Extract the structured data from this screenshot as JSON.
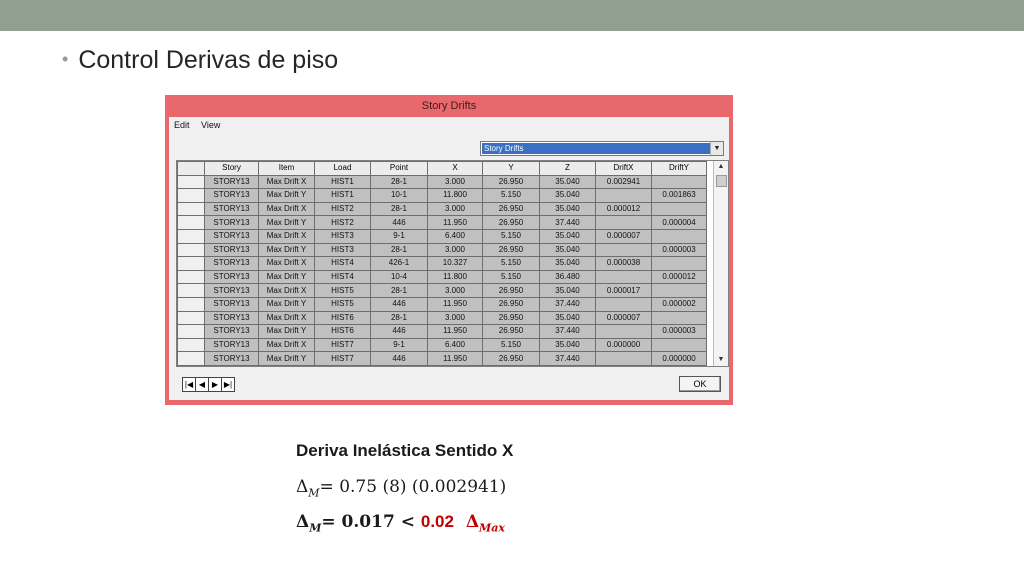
{
  "slide": {
    "title": "Control Derivas de piso",
    "bullet": "•"
  },
  "window": {
    "title": "Story Drifts",
    "menu": [
      "Edit",
      "View"
    ],
    "combo_value": "Story Drifts",
    "ok_label": "OK",
    "nav": [
      "|◀",
      "◀",
      "▶",
      "▶|"
    ],
    "columns": [
      "Story",
      "Item",
      "Load",
      "Point",
      "X",
      "Y",
      "Z",
      "DriftX",
      "DriftY"
    ],
    "rows": [
      [
        "STORY13",
        "Max Drift X",
        "HIST1",
        "28-1",
        "3.000",
        "26.950",
        "35.040",
        "0.002941",
        ""
      ],
      [
        "STORY13",
        "Max Drift Y",
        "HIST1",
        "10-1",
        "11.800",
        "5.150",
        "35.040",
        "",
        "0.001863"
      ],
      [
        "STORY13",
        "Max Drift X",
        "HIST2",
        "28-1",
        "3.000",
        "26.950",
        "35.040",
        "0.000012",
        ""
      ],
      [
        "STORY13",
        "Max Drift Y",
        "HIST2",
        "446",
        "11.950",
        "26.950",
        "37.440",
        "",
        "0.000004"
      ],
      [
        "STORY13",
        "Max Drift X",
        "HIST3",
        "9-1",
        "6.400",
        "5.150",
        "35.040",
        "0.000007",
        ""
      ],
      [
        "STORY13",
        "Max Drift Y",
        "HIST3",
        "28-1",
        "3.000",
        "26.950",
        "35.040",
        "",
        "0.000003"
      ],
      [
        "STORY13",
        "Max Drift X",
        "HIST4",
        "426-1",
        "10.327",
        "5.150",
        "35.040",
        "0.000038",
        ""
      ],
      [
        "STORY13",
        "Max Drift Y",
        "HIST4",
        "10-4",
        "11.800",
        "5.150",
        "36.480",
        "",
        "0.000012"
      ],
      [
        "STORY13",
        "Max Drift X",
        "HIST5",
        "28-1",
        "3.000",
        "26.950",
        "35.040",
        "0.000017",
        ""
      ],
      [
        "STORY13",
        "Max Drift Y",
        "HIST5",
        "446",
        "11.950",
        "26.950",
        "37.440",
        "",
        "0.000002"
      ],
      [
        "STORY13",
        "Max Drift X",
        "HIST6",
        "28-1",
        "3.000",
        "26.950",
        "35.040",
        "0.000007",
        ""
      ],
      [
        "STORY13",
        "Max Drift Y",
        "HIST6",
        "446",
        "11.950",
        "26.950",
        "37.440",
        "",
        "0.000003"
      ],
      [
        "STORY13",
        "Max Drift X",
        "HIST7",
        "9-1",
        "6.400",
        "5.150",
        "35.040",
        "0.000000",
        ""
      ],
      [
        "STORY13",
        "Max Drift Y",
        "HIST7",
        "446",
        "11.950",
        "26.950",
        "37.440",
        "",
        "0.000000"
      ]
    ]
  },
  "formula": {
    "title": "Deriva Inelástica Sentido X",
    "delta": "Δ",
    "sub_m": "M",
    "line1_rest": "= 0.75 (8) (0.002941)",
    "line2_rest": "= 0.017 < ",
    "limit": "0.02",
    "sub_max": "Max"
  },
  "colors": {
    "topbar": "#8fa091",
    "window_frame": "#e8686d",
    "cell_bg": "#c0c0c0",
    "highlight": "#3a6fc4",
    "limit_red": "#c00000"
  }
}
